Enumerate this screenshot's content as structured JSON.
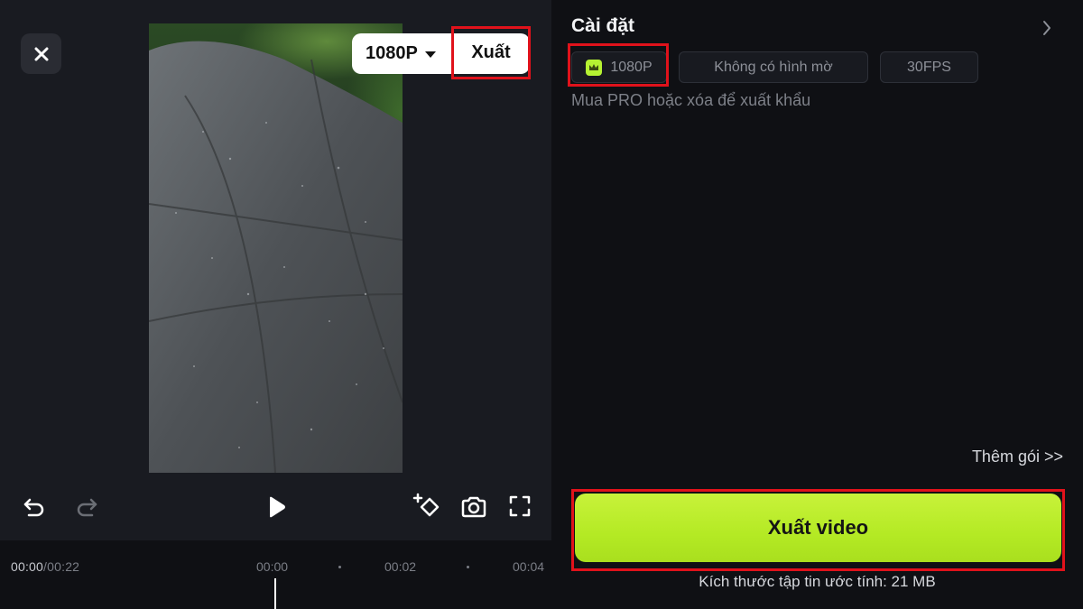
{
  "preview_controls": {
    "resolution": "1080P",
    "export_label": "Xuất"
  },
  "playback": {
    "current_time": "00:00",
    "duration": "/00:22",
    "ruler_ticks": [
      "00:00",
      "00:02",
      "00:04"
    ]
  },
  "toolbar_icons": [
    "close-icon",
    "undo-icon",
    "redo-icon",
    "play-icon",
    "add-keyframe-icon",
    "camera-icon",
    "fullscreen-icon"
  ],
  "settings": {
    "title": "Cài đặt",
    "chips": [
      {
        "label": "1080P",
        "pro": true
      },
      {
        "label": "Không có hình mờ",
        "pro": false
      },
      {
        "label": "30FPS",
        "pro": false
      }
    ],
    "hint": "Mua PRO hoặc xóa để xuất khẩu",
    "more_packages": "Thêm gói >>",
    "export_button": "Xuất video",
    "estimated_size": "Kích thước tập tin ước tính: 21 MB"
  },
  "colors": {
    "accent": "#b4ea24",
    "highlight_border": "#e0121b",
    "panel_bg": "#191b21"
  }
}
